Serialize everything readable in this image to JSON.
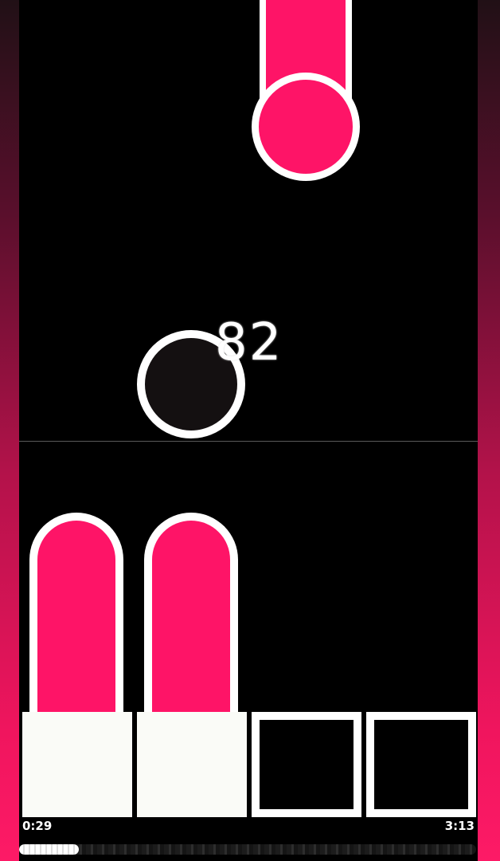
{
  "game": {
    "combo": "82",
    "lanes": [
      {
        "key_state": "pressed",
        "hold_note": true
      },
      {
        "key_state": "pressed",
        "hold_note": true
      },
      {
        "key_state": "idle",
        "hold_note": false
      },
      {
        "key_state": "idle",
        "hold_note": false
      }
    ]
  },
  "playback": {
    "current_time": "0:29",
    "total_time": "3:13",
    "progress": 0.13
  },
  "colors": {
    "note": "#fe1467",
    "outline": "#ffffff",
    "background": "#000000",
    "side_gradient_top": "#211016",
    "side_gradient_bottom": "#fd1a66"
  },
  "icons": {
    "tap_target": "circle-target-icon",
    "note": "hold-note-icon"
  }
}
